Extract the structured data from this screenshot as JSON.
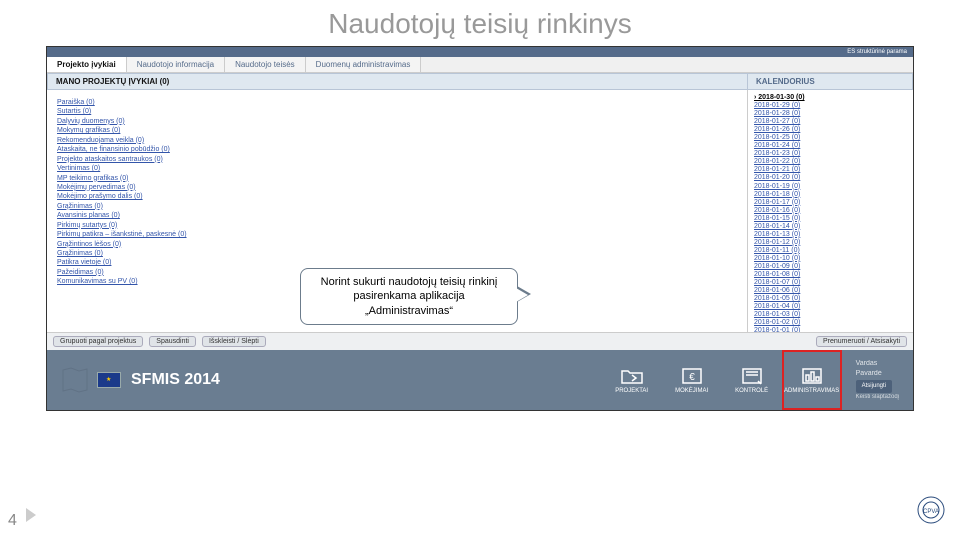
{
  "title": "Naudotojų teisių rinkinys",
  "topbar": "ES struktūrinė parama",
  "tabs": [
    {
      "label": "Projekto įvykiai",
      "active": true
    },
    {
      "label": "Naudotojo informacija",
      "active": false
    },
    {
      "label": "Naudotojo teisės",
      "active": false
    },
    {
      "label": "Duomenų administravimas",
      "active": false
    }
  ],
  "subHeaderLeft": "MANO PROJEKTŲ ĮVYKIAI (0)",
  "subHeaderRight": "KALENDORIUS",
  "events": [
    "Paraiška (0)",
    "Sutartis (0)",
    "Dalyvių duomenys (0)",
    "Mokymų grafikas (0)",
    "Rekomenduojama veikla (0)",
    "Ataskaita, ne finansinio pobūdžio (0)",
    "Projekto ataskaitos santraukos (0)",
    "Vertinimas (0)",
    "MP teikimo grafikas (0)",
    "Mokėjimų pervedimas (0)",
    "Mokėjimo prašymo dalis (0)",
    "Grąžinimas (0)",
    "Avansinis planas (0)",
    "Pirkimų sutartys (0)",
    "Pirkimų patikra – išankstinė, paskesnė (0)",
    "Grąžintinos lėšos (0)",
    "Grąžinimas (0)",
    "Patikra vietoje (0)",
    "Pažeidimas (0)",
    "Komunikavimas su PV (0)"
  ],
  "calendar": [
    "2018-01-30 (0)",
    "2018-01-29 (0)",
    "2018-01-28 (0)",
    "2018-01-27 (0)",
    "2018-01-26 (0)",
    "2018-01-25 (0)",
    "2018-01-24 (0)",
    "2018-01-23 (0)",
    "2018-01-22 (0)",
    "2018-01-21 (0)",
    "2018-01-20 (0)",
    "2018-01-19 (0)",
    "2018-01-18 (0)",
    "2018-01-17 (0)",
    "2018-01-16 (0)",
    "2018-01-15 (0)",
    "2018-01-14 (0)",
    "2018-01-13 (0)",
    "2018-01-12 (0)",
    "2018-01-11 (0)",
    "2018-01-10 (0)",
    "2018-01-09 (0)",
    "2018-01-08 (0)",
    "2018-01-07 (0)",
    "2018-01-06 (0)",
    "2018-01-05 (0)",
    "2018-01-04 (0)",
    "2018-01-03 (0)",
    "2018-01-02 (0)",
    "2018-01-01 (0)"
  ],
  "callout": "Norint sukurti naudotojų teisių rinkinį pasirenkama aplikacija „Administravimas“",
  "toolbar": {
    "group": "Grupuoti pagal projektus",
    "print": "Spausdinti",
    "expand": "Išskleisti / Slėpti",
    "subscribe": "Prenumeruoti / Atsisakyti"
  },
  "brand": "SFMIS 2014",
  "nav": [
    {
      "key": "projektai",
      "label": "PROJEKTAI"
    },
    {
      "key": "mokejimai",
      "label": "MOKĖJIMAI"
    },
    {
      "key": "kontrole",
      "label": "KONTROLĖ"
    },
    {
      "key": "administravimas",
      "label": "ADMINISTRAVIMAS"
    }
  ],
  "user": {
    "name": "Vardas",
    "surname": "Pavardė",
    "logout": "Atsijungti",
    "changePw": "Keisti slaptažodį"
  },
  "pageNum": "4"
}
